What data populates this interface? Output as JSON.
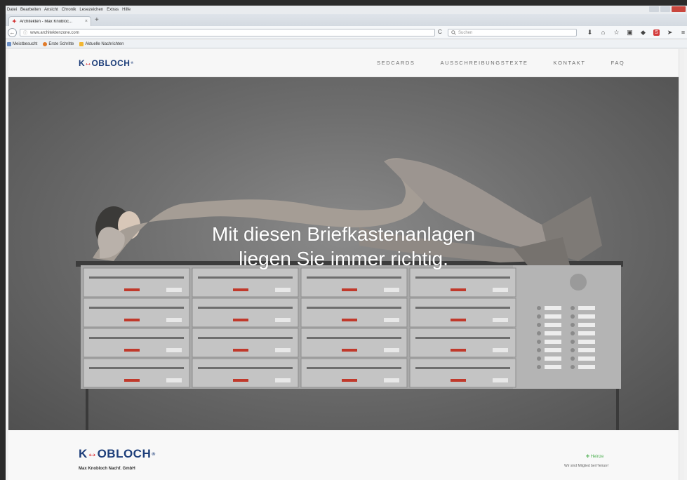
{
  "browser": {
    "menu": [
      "Datei",
      "Bearbeiten",
      "Ansicht",
      "Chronik",
      "Lesezeichen",
      "Extras",
      "Hilfe"
    ],
    "tab": {
      "title": "Architekten - Max Knobloc...",
      "close": "×"
    },
    "new_tab": "+",
    "back": "←",
    "url": "www.architektenzone.com",
    "url_info": "ⓘ",
    "reload": "C",
    "search_icon": "🔍",
    "search_placeholder": "Suchen",
    "toolbar_icons": [
      "download-icon",
      "home-icon",
      "bookmark-star-icon",
      "pocket-icon",
      "shield-icon",
      "s-addon-icon",
      "send-icon",
      "menu-icon"
    ],
    "bookmarks": [
      "Meistbesucht",
      "Erste Schritte",
      "Aktuelle Nachrichten"
    ]
  },
  "site": {
    "logo": {
      "left": "K",
      "arrow": "↔",
      "right": "OBLOCH",
      "reg": "®"
    },
    "nav": [
      "SEDCARDS",
      "AUSSCHREIBUNGSTEXTE",
      "KONTAKT",
      "FAQ"
    ],
    "hero": {
      "line1": "Mit diesen Briefkastenanlagen",
      "line2": "liegen Sie immer richtig."
    },
    "footer": {
      "company": "Max Knobloch Nachf. GmbH",
      "heinze_logo": "Heinze",
      "heinze_member": "Wir sind Mitglied bei Heinze!"
    }
  },
  "colors": {
    "brand_blue": "#1d3e7a",
    "brand_red": "#d5232b",
    "heinze_green": "#4caf50"
  }
}
